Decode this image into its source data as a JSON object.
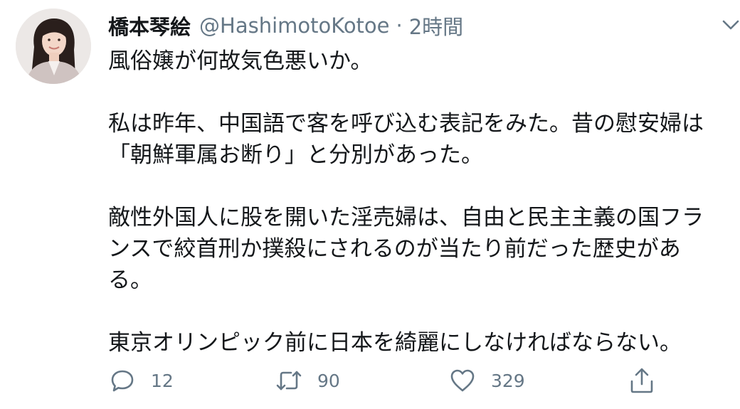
{
  "tweet": {
    "display_name": "橋本琴絵",
    "handle": "@HashimotoKotoe",
    "separator": "·",
    "timestamp": "2時間",
    "paragraphs": [
      [
        "風俗嬢が何故気色悪いか。"
      ],
      [
        "私は昨年、中国語で客を呼び込む表記をみた。昔の慰安婦は",
        "「朝鮮軍属お断り」と分別があった。"
      ],
      [
        "敵性外国人に股を開いた淫売婦は、自由と民主主義の国フラ",
        "ンスで絞首刑か撲殺にされるのが当たり前だった歴史があ",
        "る。"
      ],
      [
        "東京オリンピック前に日本を綺麗にしなければならない。"
      ]
    ],
    "actions": {
      "reply_count": "12",
      "retweet_count": "90",
      "like_count": "329"
    }
  },
  "icons": {
    "avatar": "profile-photo",
    "caret": "chevron-down-icon",
    "reply": "reply-icon",
    "retweet": "retweet-icon",
    "like": "heart-icon",
    "share": "share-icon"
  },
  "colors": {
    "text": "#14171a",
    "secondary": "#657786",
    "background": "#ffffff"
  }
}
